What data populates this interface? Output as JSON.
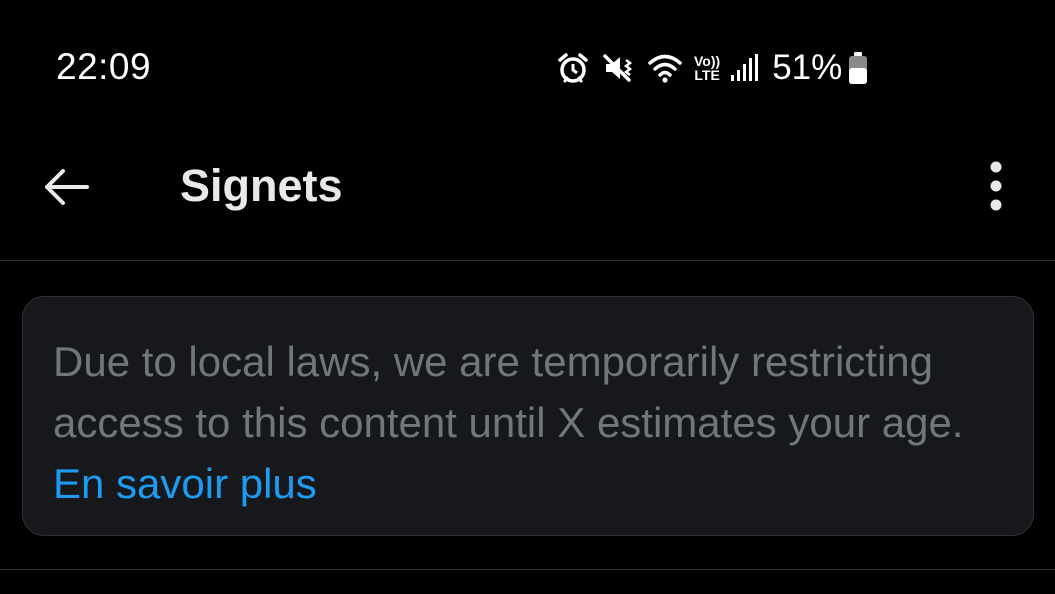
{
  "status_bar": {
    "time": "22:09",
    "icons": [
      "alarm-icon",
      "vibrate-mute-icon",
      "wifi-icon",
      "volte-icon",
      "signal-icon",
      "battery-icon"
    ],
    "volte_top": "Vo))",
    "volte_bottom": "LTE",
    "battery_percent": "51%"
  },
  "header": {
    "title": "Signets",
    "back_icon": "arrow-left-icon",
    "more_icon": "more-vertical-icon"
  },
  "notice": {
    "text": "Due to local laws, we are temporarily restricting access to this content until X estimates your age.",
    "link_label": "En savoir plus"
  },
  "colors": {
    "background": "#000000",
    "title": "#e7e9ea",
    "notice_text": "#71767b",
    "link": "#1d9bf0",
    "notice_background": "#16181c",
    "border": "#2f3336"
  }
}
